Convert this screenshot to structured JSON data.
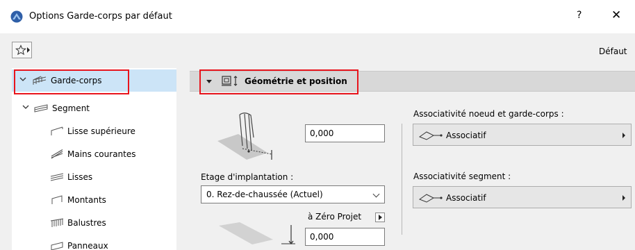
{
  "window": {
    "title": "Options Garde-corps par défaut",
    "help_label": "?",
    "close_label": "✕"
  },
  "toolbar": {
    "default_label": "Défaut"
  },
  "tree": {
    "items": [
      {
        "label": "Garde-corps",
        "icon": "railing-icon",
        "selected": true,
        "expanded": true
      },
      {
        "label": "Segment",
        "icon": "segment-icon",
        "expanded": true
      },
      {
        "label": "Lisse supérieure",
        "icon": "top-rail-icon"
      },
      {
        "label": "Mains courantes",
        "icon": "handrail-icon"
      },
      {
        "label": "Lisses",
        "icon": "rails-icon"
      },
      {
        "label": "Montants",
        "icon": "posts-icon"
      },
      {
        "label": "Balustres",
        "icon": "balusters-icon"
      },
      {
        "label": "Panneaux",
        "icon": "panels-icon"
      }
    ]
  },
  "panel": {
    "header_title": "Géométrie et position",
    "height_value": "0,000",
    "story_label": "Etage d'implantation :",
    "story_value": "0. Rez-de-chaussée (Actuel)",
    "zero_label": "à Zéro Projet",
    "elevation_value": "0,000",
    "node_assoc_label": "Associativité noeud et garde-corps :",
    "node_assoc_value": "Associatif",
    "segment_assoc_label": "Associativité segment :",
    "segment_assoc_value": "Associatif"
  },
  "colors": {
    "selection": "#cce4f7",
    "highlight": "#e8141c",
    "header_bg": "#d8d8d8"
  }
}
